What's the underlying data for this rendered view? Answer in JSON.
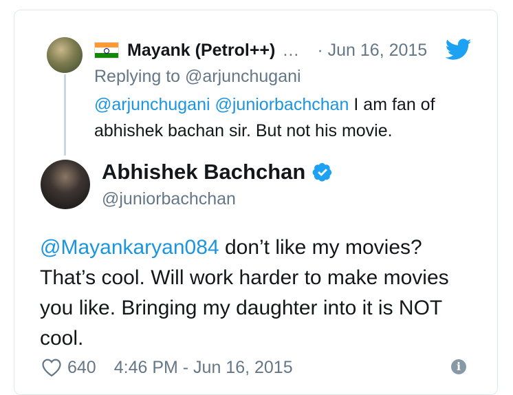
{
  "quoted_tweet": {
    "name": "Mayank (Petrol++)",
    "ellipsis": "…",
    "date": "· Jun 16, 2015",
    "replying_to": "Replying to @arjunchugani",
    "mention1": "@arjunchugani",
    "mention2": "@juniorbachchan",
    "text_rest": " I am fan of abhishek bachan sir. But not his movie."
  },
  "main_tweet": {
    "name": "Abhishek Bachchan",
    "handle": "@juniorbachchan",
    "mention": "@Mayankaryan084",
    "text_rest": " don’t like my movies? That’s cool. Will work harder to make movies you like. Bringing my daughter into it is NOT cool.",
    "likes": "640",
    "timestamp": "4:46 PM - Jun 16, 2015"
  },
  "colors": {
    "link": "#1b95e0",
    "muted": "#657786",
    "thread_line": "#ccd6dd"
  },
  "icons": [
    "india-flag-icon",
    "twitter-bird-icon",
    "verified-badge-icon",
    "heart-icon",
    "info-icon"
  ]
}
